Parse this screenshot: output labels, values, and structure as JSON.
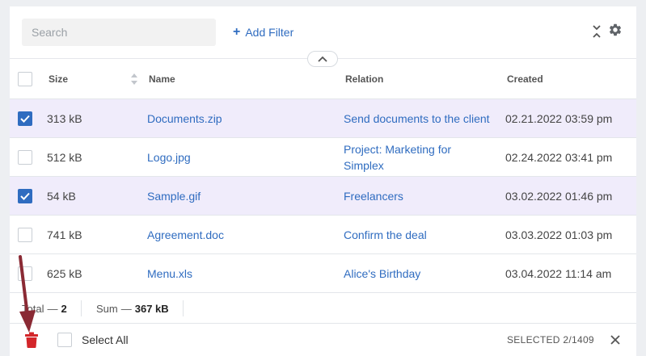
{
  "toolbar": {
    "search_placeholder": "Search",
    "add_filter_label": "Add Filter",
    "add_filter_icon": "plus-icon",
    "collapse_icon": "collapse-icon",
    "settings_icon": "gear-icon"
  },
  "table": {
    "columns": {
      "size": "Size",
      "name": "Name",
      "relation": "Relation",
      "created": "Created"
    },
    "rows": [
      {
        "checked": true,
        "size": "313 kB",
        "name": "Documents.zip",
        "relation": "Send documents to the client",
        "created": "02.21.2022 03:59 pm"
      },
      {
        "checked": false,
        "size": "512 kB",
        "name": "Logo.jpg",
        "relation": "Project: Marketing for Simplex",
        "created": "02.24.2022 03:41 pm"
      },
      {
        "checked": true,
        "size": "54 kB",
        "name": "Sample.gif",
        "relation": "Freelancers",
        "created": "03.02.2022 01:46 pm"
      },
      {
        "checked": false,
        "size": "741 kB",
        "name": "Agreement.doc",
        "relation": "Confirm the deal",
        "created": "03.03.2022 01:03 pm"
      },
      {
        "checked": false,
        "size": "625 kB",
        "name": "Menu.xls",
        "relation": "Alice's Birthday",
        "created": "03.04.2022 11:14 am"
      }
    ]
  },
  "totals": {
    "total_label": "Total",
    "total_value": "2",
    "sum_label": "Sum",
    "sum_value": "367 kB"
  },
  "actionbar": {
    "select_all_label": "Select All",
    "selected_count": "SELECTED 2/1409",
    "delete_icon": "trash-icon",
    "close_icon": "close-icon"
  },
  "colors": {
    "accent": "#2f6cc0",
    "selected_row": "#f0ecfb",
    "delete": "#d3262a",
    "annotation_arrow": "#8a2a34"
  }
}
